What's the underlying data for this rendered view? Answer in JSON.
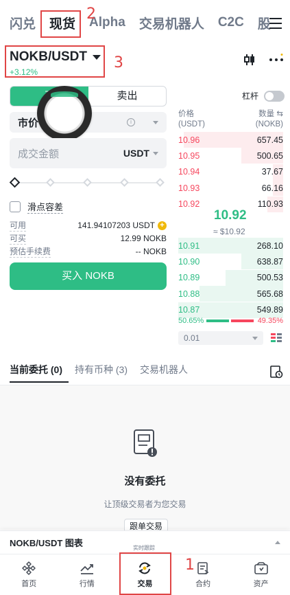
{
  "topnav": {
    "tabs": [
      {
        "label": "闪兑"
      },
      {
        "label": "现货"
      },
      {
        "label": "Alpha"
      },
      {
        "label": "交易机器人"
      },
      {
        "label": "C2C"
      },
      {
        "label": "股"
      }
    ],
    "active_index": 1
  },
  "annotations": {
    "n1": "1",
    "n2": "2",
    "n3": "3"
  },
  "pair": {
    "name": "NOKB/USDT",
    "change": "+3.12%"
  },
  "trade": {
    "buy_label": "买",
    "sell_label": "卖出",
    "order_type": "市价",
    "amount_placeholder": "成交金额",
    "amount_unit": "USDT",
    "slippage_label": "滑点容差",
    "available_label": "可用",
    "available_value": "141.94107203 USDT",
    "can_buy_label": "可买",
    "can_buy_value": "12.99 NOKB",
    "fee_label": "预估手续费",
    "fee_value": "-- NOKB",
    "submit_label": "买入 NOKB",
    "leverage_label": "杠杆"
  },
  "orderbook": {
    "price_header": "价格",
    "price_unit": "(USDT)",
    "qty_header": "数量 ⇆",
    "qty_unit": "(NOKB)",
    "asks": [
      {
        "price": "10.96",
        "qty": "657.45",
        "depth": 0.95
      },
      {
        "price": "10.95",
        "qty": "500.65",
        "depth": 0.4
      },
      {
        "price": "10.94",
        "qty": "37.67",
        "depth": 0.1
      },
      {
        "price": "10.93",
        "qty": "66.16",
        "depth": 0.1
      },
      {
        "price": "10.92",
        "qty": "110.93",
        "depth": 0.15
      }
    ],
    "mid_price": "10.92",
    "mid_usd": "≈ $10.92",
    "bids": [
      {
        "price": "10.91",
        "qty": "268.10",
        "depth": 1.0
      },
      {
        "price": "10.90",
        "qty": "638.87",
        "depth": 0.4
      },
      {
        "price": "10.89",
        "qty": "500.53",
        "depth": 0.55
      },
      {
        "price": "10.88",
        "qty": "565.68",
        "depth": 0.8
      },
      {
        "price": "10.87",
        "qty": "549.89",
        "depth": 1.0
      }
    ],
    "buy_ratio": "50.65%",
    "sell_ratio": "49.35%",
    "buy_ratio_value": 50.65,
    "tick_size": "0.01"
  },
  "orders": {
    "tabs": [
      {
        "label": "当前委托 (0)"
      },
      {
        "label": "持有币种 (3)"
      },
      {
        "label": "交易机器人"
      }
    ],
    "empty_title": "没有委托",
    "empty_sub": "让顶级交易者为您交易",
    "copy_button": "跟单交易"
  },
  "chart_bar": {
    "label": "NOKB/USDT 图表",
    "floating": "实时跟踪"
  },
  "bottom_nav": [
    {
      "label": "首页",
      "icon": "home-icon"
    },
    {
      "label": "行情",
      "icon": "markets-icon"
    },
    {
      "label": "交易",
      "icon": "trade-icon"
    },
    {
      "label": "合约",
      "icon": "futures-icon"
    },
    {
      "label": "资产",
      "icon": "wallet-icon"
    }
  ],
  "colors": {
    "green": "#2ebd85",
    "red": "#f6465d",
    "annotation": "#e04545"
  }
}
